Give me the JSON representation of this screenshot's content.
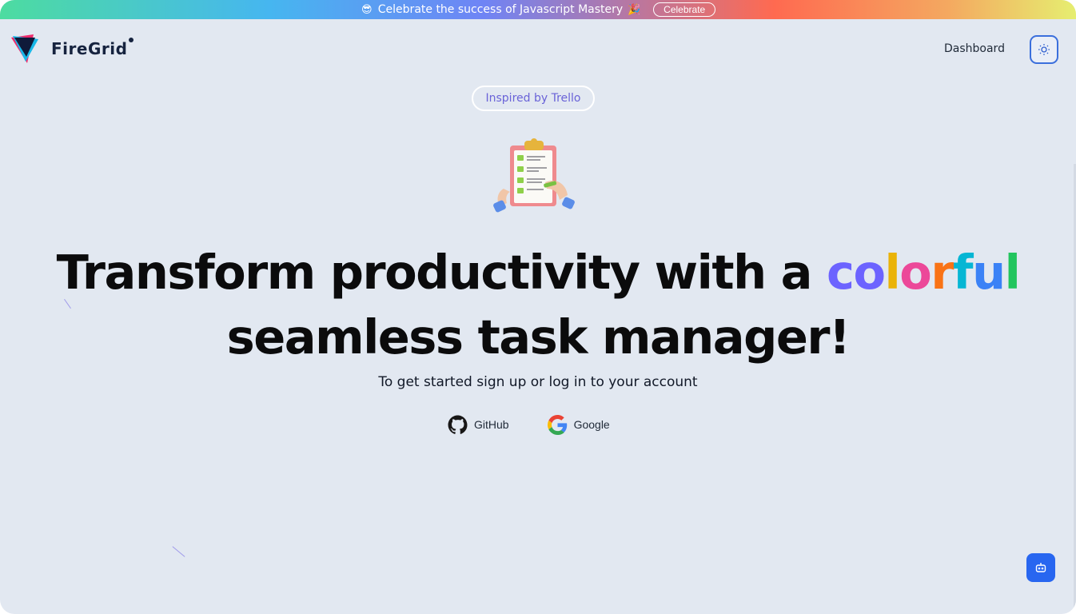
{
  "announcement": {
    "left_emoji": "😎",
    "text": "Celebrate the success of Javascript Mastery",
    "right_emoji": "🎉",
    "button_label": "Celebrate"
  },
  "header": {
    "brand": "FireGrid",
    "nav_dashboard": "Dashboard",
    "theme_icon": "sun-icon"
  },
  "hero": {
    "badge": "Inspired by Trello",
    "illustration": "clipboard-checklist-illustration",
    "headline_part1": "Transform productivity with a ",
    "headline_colorful": [
      "c",
      "o",
      "l",
      "o",
      "r",
      "f",
      "u",
      "l"
    ],
    "headline_line2": "seamless task manager!",
    "subtitle": "To get started sign up or log in to your account"
  },
  "auth": {
    "github_label": "GitHub",
    "google_label": "Google"
  },
  "assistant": {
    "icon": "bot-icon"
  },
  "colors": {
    "background": "#e2e8f1",
    "brand_text": "#16233f",
    "accent": "#2866f0",
    "badge_text": "#6a63d8",
    "colorful_letters": [
      "#6c63ff",
      "#6c63ff",
      "#eab308",
      "#ec4899",
      "#f97316",
      "#06b6d4",
      "#3b82f6",
      "#22c55e"
    ]
  }
}
